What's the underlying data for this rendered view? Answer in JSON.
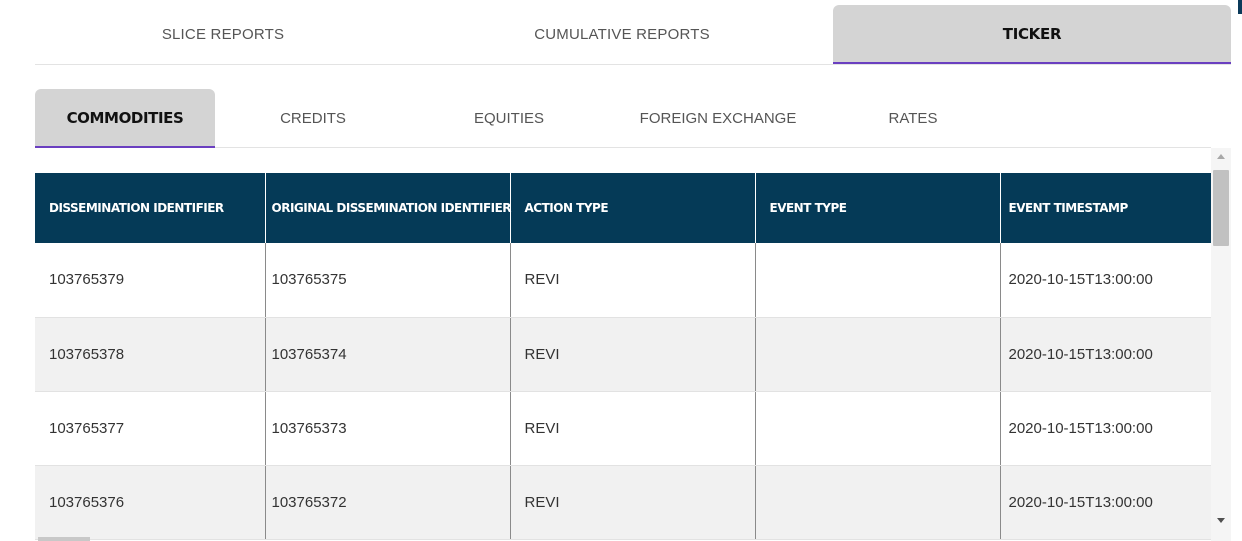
{
  "top_tabs": [
    {
      "label": "SLICE REPORTS",
      "active": false
    },
    {
      "label": "CUMULATIVE REPORTS",
      "active": false
    },
    {
      "label": "TICKER",
      "active": true
    }
  ],
  "sub_tabs": [
    {
      "label": "COMMODITIES",
      "active": true
    },
    {
      "label": "CREDITS",
      "active": false
    },
    {
      "label": "EQUITIES",
      "active": false
    },
    {
      "label": "FOREIGN EXCHANGE",
      "active": false
    },
    {
      "label": "RATES",
      "active": false
    }
  ],
  "table": {
    "columns": [
      "DISSEMINATION IDENTIFIER",
      "ORIGINAL DISSEMINATION IDENTIFIER",
      "ACTION TYPE",
      "EVENT TYPE",
      "EVENT TIMESTAMP"
    ],
    "rows": [
      [
        "103765379",
        "103765375",
        "REVI",
        "",
        "2020-10-15T13:00:00"
      ],
      [
        "103765378",
        "103765374",
        "REVI",
        "",
        "2020-10-15T13:00:00"
      ],
      [
        "103765377",
        "103765373",
        "REVI",
        "",
        "2020-10-15T13:00:00"
      ],
      [
        "103765376",
        "103765372",
        "REVI",
        "",
        "2020-10-15T13:00:00"
      ]
    ]
  },
  "colors": {
    "header_bg": "#053a57",
    "active_tab_bg": "#d4d4d4",
    "active_tab_underline": "#6a3fc0",
    "row_alt_bg": "#f1f1f1"
  }
}
